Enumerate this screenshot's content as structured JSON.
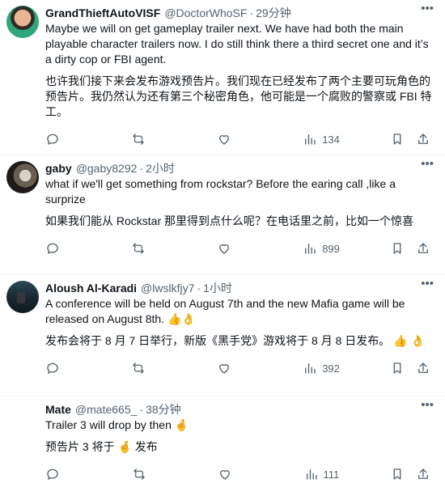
{
  "posts": [
    {
      "avatar": "avatar",
      "name": "GrandThieftAutoVISF",
      "handle": "@DoctorWhoSF",
      "time": "29分钟",
      "text": "Maybe we will on get gameplay trailer next. We have had both the main playable character trailers now. I do still think there a third secret one and it’s a dirty cop or FBI agent.",
      "translation": "也许我们接下来会发布游戏预告片。我们现在已经发布了两个主要可玩角色的预告片。我仍然认为还有第三个秘密角色，他可能是一个腐败的警察或 FBI 特工。",
      "views": "134"
    },
    {
      "avatar": "avatar",
      "name": "gaby",
      "handle": "@gaby8292",
      "time": "2小时",
      "text": "what if we'll get something from rockstar? Before the earing call ,like a surprize",
      "translation": "如果我们能从 Rockstar 那里得到点什么呢？在电话里之前，比如一个惊喜",
      "views": "899"
    },
    {
      "avatar": "avatar",
      "name": "Aloush Al-Karadi",
      "handle": "@lwslkfjy7",
      "time": "1小时",
      "text": "A conference will be held on August 7th and the new Mafia game will be released on August 8th. 👍👌",
      "translation": "发布会将于 8 月 7 日举行，新版《黑手党》游戏将于 8 月 8 日发布。 👍 👌",
      "views": "392"
    },
    {
      "avatar": "avatar",
      "name": "Mate",
      "handle": "@mate665_",
      "time": "38分钟",
      "text": "Trailer 3 will drop by then 🤞",
      "translation": "预告片 3 将于 🤞 发布",
      "views": "111"
    }
  ],
  "ui": {
    "dot": "·",
    "more_icon": "more-icon",
    "reply_icon": "reply-icon",
    "repost_icon": "repost-icon",
    "like_icon": "like-icon",
    "views_icon": "views-icon",
    "bookmark_icon": "bookmark-icon",
    "share_icon": "share-icon"
  }
}
